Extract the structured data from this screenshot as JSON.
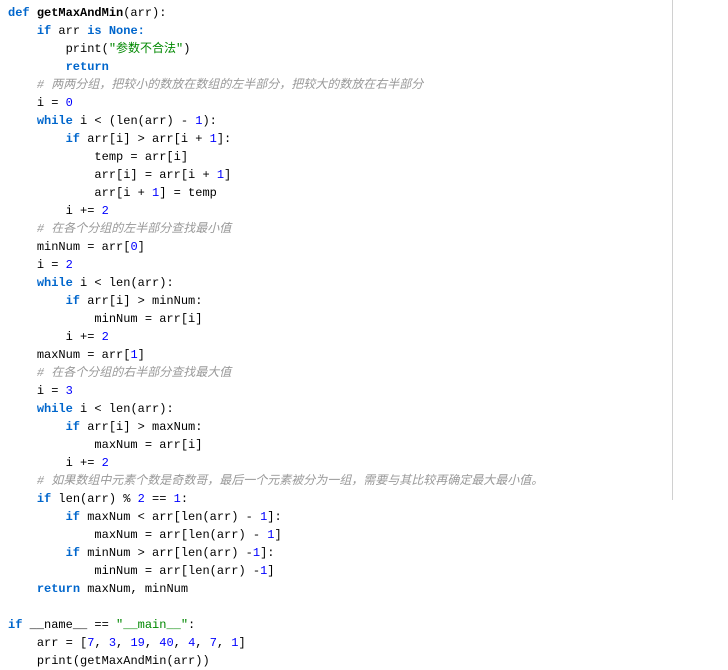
{
  "code": {
    "l01_def": "def",
    "l01_fn": "getMaxAndMin",
    "l01_rest": "(arr):",
    "l02_if": "if",
    "l02_mid": " arr ",
    "l02_is": "is",
    "l02_none": " None:",
    "l03_print": "print",
    "l03_paren_open": "(",
    "l03_str": "\"参数不合法\"",
    "l03_paren_close": ")",
    "l04_return": "return",
    "l05_cmt": "# 两两分组，把较小的数放在数组的左半部分，把较大的数放在右半部分",
    "l06_a": "i = ",
    "l06_n": "0",
    "l07_while": "while",
    "l07_mid": " i < (",
    "l07_len": "len",
    "l07_rest": "(arr) - ",
    "l07_n": "1",
    "l07_end": "):",
    "l08_if": "if",
    "l08_a": " arr[i] > arr[i + ",
    "l08_n": "1",
    "l08_end": "]:",
    "l09": "temp = arr[i]",
    "l10_a": "arr[i] = arr[i + ",
    "l10_n": "1",
    "l10_end": "]",
    "l11_a": "arr[i + ",
    "l11_n": "1",
    "l11_end": "] = temp",
    "l12_a": "i += ",
    "l12_n": "2",
    "l13_cmt": "# 在各个分组的左半部分查找最小值",
    "l14_a": "minNum = arr[",
    "l14_n": "0",
    "l14_end": "]",
    "l15_a": "i = ",
    "l15_n": "2",
    "l16_while": "while",
    "l16_mid": " i < ",
    "l16_len": "len",
    "l16_end": "(arr):",
    "l17_if": "if",
    "l17_rest": " arr[i] > minNum:",
    "l18": "minNum = arr[i]",
    "l19_a": "i += ",
    "l19_n": "2",
    "l20_a": "maxNum = arr[",
    "l20_n": "1",
    "l20_end": "]",
    "l21_cmt": "# 在各个分组的右半部分查找最大值",
    "l22_a": "i = ",
    "l22_n": "3",
    "l23_while": "while",
    "l23_mid": " i < ",
    "l23_len": "len",
    "l23_end": "(arr):",
    "l24_if": "if",
    "l24_rest": " arr[i] > maxNum:",
    "l25": "maxNum = arr[i]",
    "l26_a": "i += ",
    "l26_n": "2",
    "l27_cmt": "# 如果数组中元素个数是奇数哥，最后一个元素被分为一组，需要与其比较再确定最大最小值。",
    "l28_if": "if",
    "l28_mid": " ",
    "l28_len": "len",
    "l28_a": "(arr) % ",
    "l28_n2": "2",
    "l28_eq": " == ",
    "l28_n1": "1",
    "l28_end": ":",
    "l29_if": "if",
    "l29_a": " maxNum < arr[",
    "l29_len": "len",
    "l29_b": "(arr) - ",
    "l29_n": "1",
    "l29_end": "]:",
    "l30_a": "maxNum = arr[",
    "l30_len": "len",
    "l30_b": "(arr) - ",
    "l30_n": "1",
    "l30_end": "]",
    "l31_if": "if",
    "l31_a": " minNum > arr[",
    "l31_len": "len",
    "l31_b": "(arr) -",
    "l31_n": "1",
    "l31_end": "]:",
    "l32_a": "minNum = arr[",
    "l32_len": "len",
    "l32_b": "(arr) -",
    "l32_n": "1",
    "l32_end": "]",
    "l33_return": "return",
    "l33_rest": " maxNum, minNum",
    "l34_if": "if",
    "l34_name": " __name__ == ",
    "l34_str": "\"__main__\"",
    "l34_end": ":",
    "l35_a": "arr = [",
    "l35_n1": "7",
    "l35_c": ", ",
    "l35_n2": "3",
    "l35_n3": "19",
    "l35_n4": "40",
    "l35_n5": "4",
    "l35_n6": "7",
    "l35_n7": "1",
    "l35_end": "]",
    "l36_print": "print",
    "l36_rest": "(getMaxAndMin(arr))"
  }
}
